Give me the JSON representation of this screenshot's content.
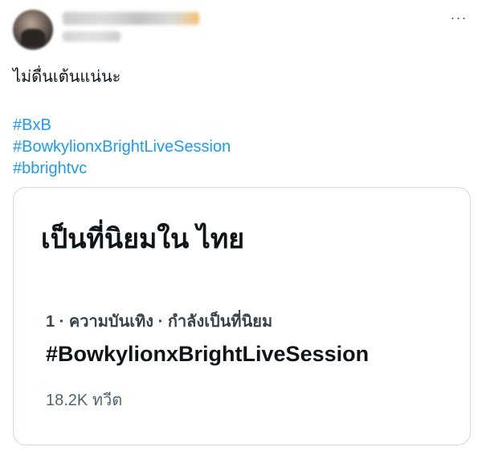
{
  "tweet": {
    "menu_icon": "more-horizontal-icon",
    "text": "ไม่ดื่นเต้นแน่นะ",
    "hashtags": [
      "#BxB",
      "#BowkylionxBrightLiveSession",
      "#bbrightvc"
    ]
  },
  "card": {
    "title": "เป็นที่นิยมใน ไทย",
    "trend_meta": "1 · ความบันเทิง · กำลังเป็นที่นิยม",
    "trend_name": "#BowkylionxBrightLiveSession",
    "trend_count": "18.2K ทวีต"
  },
  "colors": {
    "link": "#1d9bf0",
    "text": "#0f1419",
    "secondary": "#536471",
    "border": "#cfd9de"
  }
}
